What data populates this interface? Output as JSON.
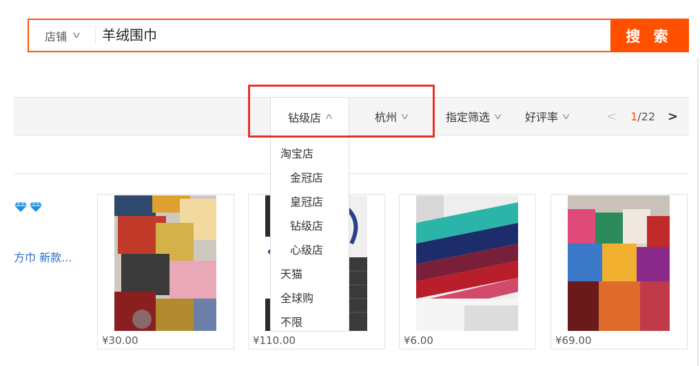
{
  "search": {
    "scope_label": "店铺",
    "query": "羊绒围巾",
    "button_label": "搜 索"
  },
  "filters": {
    "tabs": [
      {
        "label": "钻级店"
      },
      {
        "label": "杭州"
      },
      {
        "label": "指定筛选"
      },
      {
        "label": "好评率"
      }
    ],
    "pager": {
      "current": "1",
      "total": "/22"
    }
  },
  "dropdown": {
    "items": [
      {
        "label": "淘宝店"
      },
      {
        "label": "金冠店"
      },
      {
        "label": "皇冠店"
      },
      {
        "label": "钻级店"
      },
      {
        "label": "心级店"
      },
      {
        "label": "天猫"
      },
      {
        "label": "全球购"
      },
      {
        "label": "不限"
      }
    ]
  },
  "left_result": {
    "title": "方巾 新款..."
  },
  "products": [
    {
      "price": "¥30.00"
    },
    {
      "price": "¥110.00"
    },
    {
      "price": "¥6.00"
    },
    {
      "price": "¥69.00"
    }
  ],
  "colors": {
    "accent": "#ff5000",
    "highlight": "#e8302a",
    "link": "#2c6cc6"
  }
}
